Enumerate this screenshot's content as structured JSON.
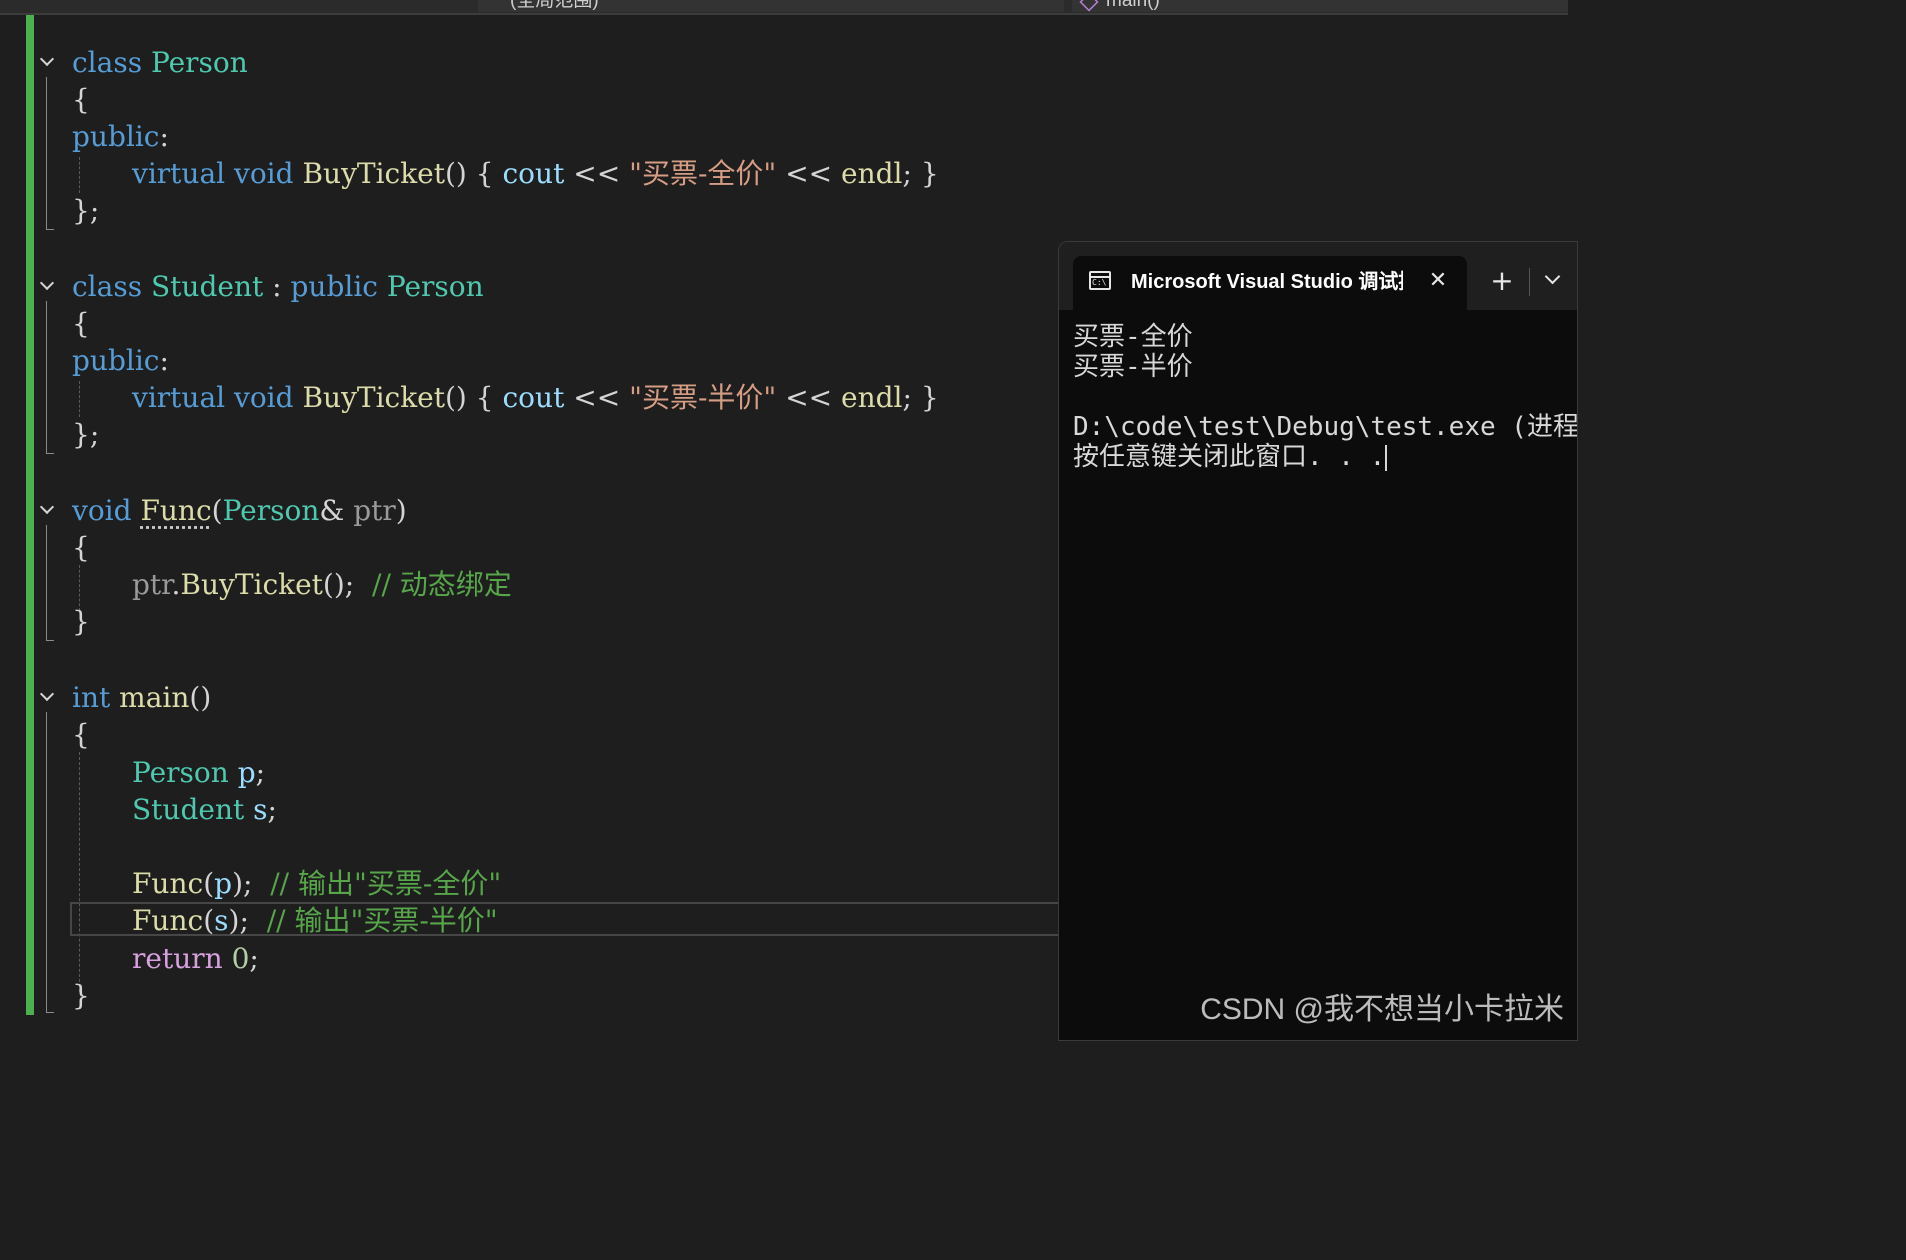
{
  "navbar": {
    "scope": "(全局范围)",
    "function": "main()"
  },
  "editor": {
    "code": {
      "l1_kw_class": "class",
      "l1_name": "Person",
      "brace_open": "{",
      "public": "public",
      "colon": ":",
      "virtual": "virtual",
      "void": "void",
      "buyticket": "BuyTicket",
      "parens": "()",
      "cout": "cout",
      "shift": "<<",
      "str_full": "\"买票-全价\"",
      "str_half": "\"买票-半价\"",
      "endl": "endl",
      "semi": ";",
      "brace_close": "}",
      "class_end": "};",
      "l2_name": "Student",
      "func_name": "Func",
      "param_type": "Person",
      "amp": "&",
      "param_name": "ptr",
      "dot": ".",
      "comment_dynamic": "// 动态绑定",
      "int": "int",
      "main": "main",
      "var_p": "p",
      "var_s": "s",
      "comment_full": "// 输出\"买票-全价\"",
      "comment_half": "// 输出\"买票-半价\"",
      "return": "return",
      "zero": "0"
    }
  },
  "terminal": {
    "tab_title": "Microsoft Visual Studio 调试控制台",
    "close_glyph": "✕",
    "new_tab_glyph": "+",
    "icon_text": "C:\\",
    "lines": [
      "买票-全价",
      "买票-半价",
      "",
      "D:\\code\\test\\Debug\\test.exe (进程",
      "按任意键关闭此窗口. . ."
    ]
  },
  "watermark": "CSDN @我不想当小卡拉米"
}
